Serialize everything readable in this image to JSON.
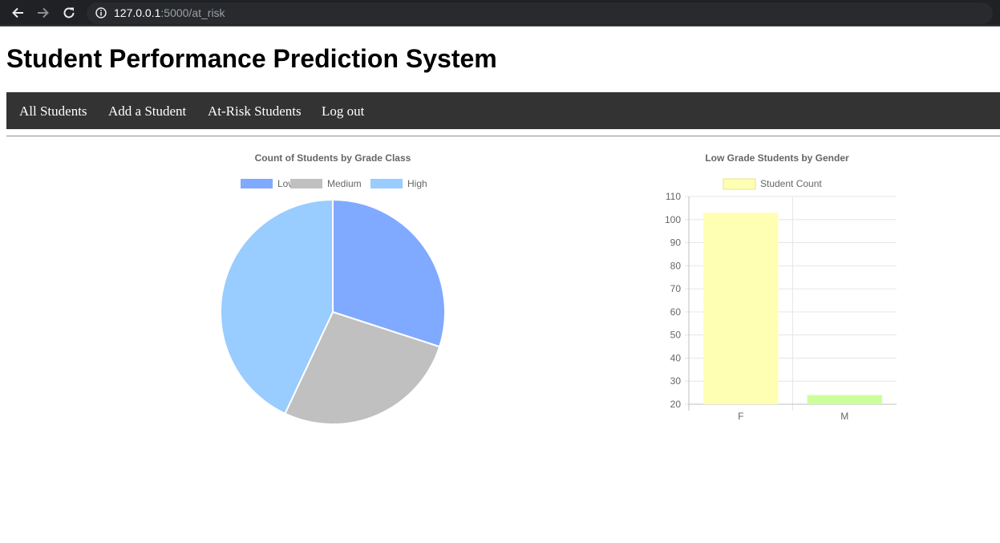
{
  "browser": {
    "url_host": "127.0.0.1",
    "url_path": ":5000/at_risk",
    "icons": [
      "back-arrow-icon",
      "forward-arrow-icon",
      "reload-icon",
      "info-icon"
    ]
  },
  "page": {
    "title": "Student Performance Prediction System"
  },
  "nav": {
    "items": [
      {
        "label": "All Students"
      },
      {
        "label": "Add a Student"
      },
      {
        "label": "At-Risk Students"
      },
      {
        "label": "Log out"
      }
    ]
  },
  "chart_data": [
    {
      "type": "pie",
      "title": "Count of Students by Grade Class",
      "legend_position": "top",
      "categories": [
        "Low",
        "Medium",
        "High"
      ],
      "values": [
        30,
        27,
        43
      ],
      "colors": [
        "#80aaff",
        "#c0c0c0",
        "#99ccff"
      ]
    },
    {
      "type": "bar",
      "title": "Low Grade Students by Gender",
      "legend_position": "top",
      "categories": [
        "F",
        "M"
      ],
      "series": [
        {
          "name": "Student Count",
          "values": [
            103,
            24
          ]
        }
      ],
      "colors": [
        "#ffffb3",
        "#ccff99"
      ],
      "ylim": [
        20,
        110
      ],
      "yticks": [
        20,
        30,
        40,
        50,
        60,
        70,
        80,
        90,
        100,
        110
      ],
      "grid": true
    }
  ]
}
